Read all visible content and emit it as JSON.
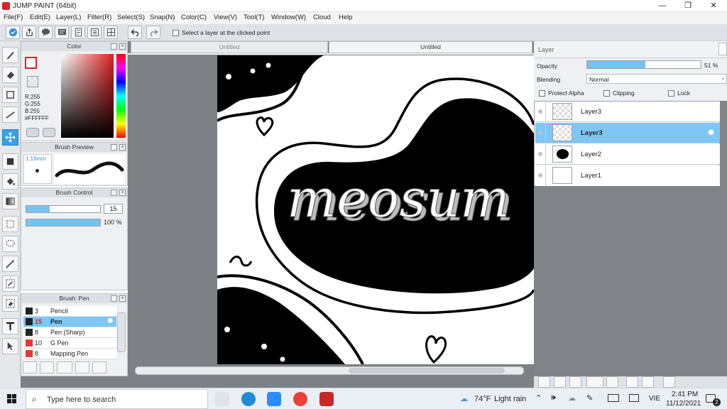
{
  "window": {
    "title": "JUMP PAINT (64bit)",
    "minimize": "—",
    "restore": "❐",
    "close": "✕"
  },
  "menu": [
    "File(F)",
    "Edit(E)",
    "Layer(L)",
    "Filter(R)",
    "Select(S)",
    "Snap(N)",
    "Color(C)",
    "View(V)",
    "Tool(T)",
    "Window(W)",
    "Cloud",
    "Help"
  ],
  "toolbar": {
    "select_layer_label": "Select a layer at the clicked point",
    "select_layer_checked": false
  },
  "color_panel": {
    "title": "Color",
    "r": "R:255",
    "g": "G:255",
    "b": "B:255",
    "hex": "#FFFFFF",
    "foreground": "#ffffff",
    "outline": "#d8232a"
  },
  "brush_preview": {
    "title": "Brush Preview",
    "size": "1.16mm"
  },
  "brush_control": {
    "title": "Brush Control",
    "size_value": "15",
    "size_fraction": 0.32,
    "opacity_value": "100 %",
    "opacity_fraction": 1.0
  },
  "brush_list": {
    "title": "Brush: Pen",
    "items": [
      {
        "size": "3",
        "name": "Pencil",
        "color": "#222222",
        "selected": false
      },
      {
        "size": "15",
        "name": "Pen",
        "color": "#222222",
        "selected": true
      },
      {
        "size": "8",
        "name": "Pen (Sharp)",
        "color": "#222222",
        "selected": false
      },
      {
        "size": "10",
        "name": "G Pen",
        "color": "#e53935",
        "selected": false
      },
      {
        "size": "8",
        "name": "Mapping Pen",
        "color": "#e53935",
        "selected": false
      }
    ]
  },
  "document_tabs": [
    {
      "label": "Untitled",
      "active": false
    },
    {
      "label": "Untitled",
      "active": true
    }
  ],
  "canvas": {
    "artwork_text": "meosum"
  },
  "layer_panel": {
    "title": "Layer",
    "opacity_label": "Opacity",
    "opacity_value": "51 %",
    "opacity_fraction": 0.51,
    "blending_label": "Blending",
    "blending_value": "Normal",
    "protect_alpha": "Protect Alpha",
    "clipping": "Clipping",
    "lock": "Lock",
    "layers": [
      {
        "name": "Layer3",
        "selected": false,
        "thumb": "transparent"
      },
      {
        "name": "Layer3",
        "selected": true,
        "thumb": "transparent"
      },
      {
        "name": "Layer2",
        "selected": false,
        "thumb": "blob"
      },
      {
        "name": "Layer1",
        "selected": false,
        "thumb": "white"
      }
    ]
  },
  "taskbar": {
    "search_placeholder": "Type here to search",
    "weather_temp": "74°F",
    "weather_desc": "Light rain",
    "language": "VIE",
    "time": "2:41 PM",
    "date": "11/12/2021",
    "notifications": "2"
  }
}
